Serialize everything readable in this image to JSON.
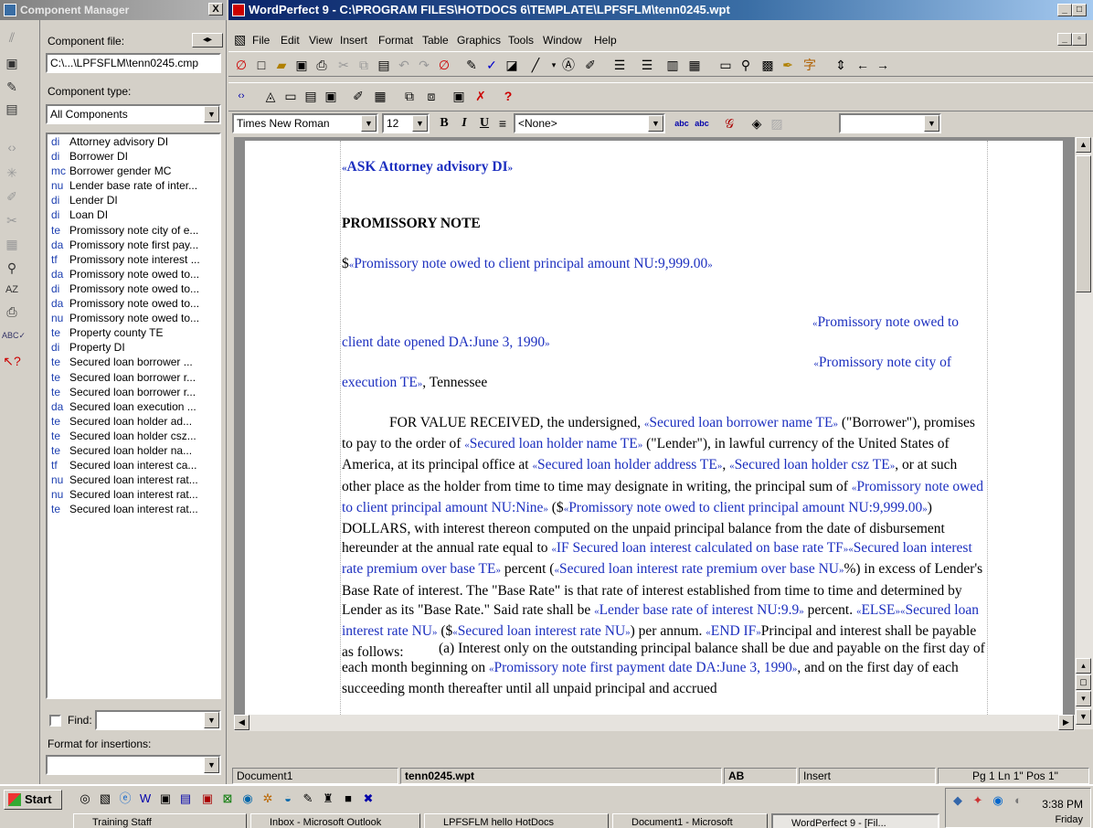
{
  "component_manager": {
    "title": "Component Manager",
    "close_label": "X",
    "file_label": "Component file:",
    "file_value": "C:\\...\\LPFSFLM\\tenn0245.cmp",
    "type_label": "Component type:",
    "type_value": "All Components",
    "items": [
      {
        "abbr": "di",
        "label": "Attorney advisory DI"
      },
      {
        "abbr": "di",
        "label": "Borrower DI"
      },
      {
        "abbr": "mc",
        "label": "Borrower gender MC"
      },
      {
        "abbr": "nu",
        "label": "Lender base rate of inter..."
      },
      {
        "abbr": "di",
        "label": "Lender DI"
      },
      {
        "abbr": "di",
        "label": "Loan DI"
      },
      {
        "abbr": "te",
        "label": "Promissory note city of e..."
      },
      {
        "abbr": "da",
        "label": "Promissory note first pay..."
      },
      {
        "abbr": "tf",
        "label": "Promissory note interest ..."
      },
      {
        "abbr": "da",
        "label": "Promissory note owed to..."
      },
      {
        "abbr": "di",
        "label": "Promissory note owed to..."
      },
      {
        "abbr": "da",
        "label": "Promissory note owed to..."
      },
      {
        "abbr": "nu",
        "label": "Promissory note owed to..."
      },
      {
        "abbr": "te",
        "label": "Property county TE"
      },
      {
        "abbr": "di",
        "label": "Property DI"
      },
      {
        "abbr": "te",
        "label": "Secured loan borrower ..."
      },
      {
        "abbr": "te",
        "label": "Secured loan borrower r..."
      },
      {
        "abbr": "te",
        "label": "Secured loan borrower r..."
      },
      {
        "abbr": "da",
        "label": "Secured loan execution ..."
      },
      {
        "abbr": "te",
        "label": "Secured loan holder ad..."
      },
      {
        "abbr": "te",
        "label": "Secured loan holder csz..."
      },
      {
        "abbr": "te",
        "label": "Secured loan holder na..."
      },
      {
        "abbr": "tf",
        "label": "Secured loan interest ca..."
      },
      {
        "abbr": "nu",
        "label": "Secured loan interest rat..."
      },
      {
        "abbr": "nu",
        "label": "Secured loan interest rat..."
      },
      {
        "abbr": "te",
        "label": "Secured loan interest rat..."
      }
    ],
    "find_label": "Find:",
    "format_label": "Format for insertions:"
  },
  "wordperfect": {
    "title": "WordPerfect 9 - C:\\PROGRAM FILES\\HOTDOCS 6\\TEMPLATE\\LPFSFLM\\tenn0245.wpt",
    "menu": [
      "File",
      "Edit",
      "View",
      "Insert",
      "Format",
      "Table",
      "Graphics",
      "Tools",
      "Window",
      "Help"
    ],
    "font_name": "Times New Roman",
    "font_size": "12",
    "style_value": "<None>",
    "bold_label": "B",
    "italic_label": "I",
    "underline_label": "U",
    "status": {
      "doc": "Document1",
      "file": "tenn0245.wpt",
      "mode_icon": "AB",
      "insert": "Insert",
      "position": "Pg 1 Ln 1\" Pos 1\""
    }
  },
  "document": {
    "advisory": "ASK Attorney advisory DI",
    "heading": "PROMISSORY NOTE",
    "amount_prefix": "$",
    "amount_field": "Promissory note owed to client principal amount NU:9,999.00",
    "date_field_a": "Promissory note owed to",
    "date_field_b": "client date opened DA:June 3, 1990",
    "city_field_a": "Promissory note city of",
    "city_field_b": "execution TE",
    "city_suffix": ", Tennessee",
    "body": [
      {
        "t": "FOR VALUE RECEIVED, the undersigned, "
      },
      {
        "f": "Secured loan borrower name TE"
      },
      {
        "t": " (\"Borrower\"), promises to pay to the order of "
      },
      {
        "f": "Secured loan holder name TE"
      },
      {
        "t": " (\"Lender\"), in lawful currency of the United States of America, at its principal office at "
      },
      {
        "f": "Secured loan holder address TE"
      },
      {
        "t": ", "
      },
      {
        "f": "Secured loan holder csz TE"
      },
      {
        "t": ", or at such other place as the holder from time to time may designate in writing, the principal sum of "
      },
      {
        "f": "Promissory note owed to client principal amount NU:Nine"
      },
      {
        "t": " ($"
      },
      {
        "f": "Promissory note owed to client principal amount NU:9,999.00"
      },
      {
        "t": ") DOLLARS, with interest thereon computed on the unpaid principal balance from the date of disbursement hereunder at the annual rate equal to "
      },
      {
        "f": "IF Secured loan interest calculated on base rate TF"
      },
      {
        "f": "Secured loan interest rate premium over base TE"
      },
      {
        "t": " percent ("
      },
      {
        "f": "Secured loan interest rate premium over base NU"
      },
      {
        "t": "%) in excess of Lender's Base Rate of interest. The \"Base Rate\" is that rate of interest established from time to time and determined by Lender as its \"Base Rate.\" Said rate shall be "
      },
      {
        "f": "Lender base rate of interest NU:9.9"
      },
      {
        "t": " percent. "
      },
      {
        "f": "ELSE"
      },
      {
        "f": "Secured loan interest rate NU"
      },
      {
        "t": " ($"
      },
      {
        "f": "Secured loan interest rate NU"
      },
      {
        "t": ") per annum. "
      },
      {
        "f": "END IF"
      },
      {
        "t": "Principal and interest shall be payable as follows:"
      }
    ],
    "para_a": [
      {
        "t": "(a) Interest only on the outstanding principal balance shall be due and payable on the first day of each month beginning on "
      },
      {
        "f": "Promissory note first payment date DA:June 3, 1990"
      },
      {
        "t": ", and on the first day of each succeeding month thereafter until all unpaid principal and accrued"
      }
    ]
  },
  "taskbar": {
    "start_label": "Start",
    "clock": "3:38 PM",
    "day": "Friday",
    "tasks": [
      "Training Staff",
      "Inbox - Microsoft Outlook",
      "LPFSFLM hello HotDocs",
      "Document1 - Microsoft",
      "WordPerfect 9 - [Fil..."
    ]
  },
  "colors": {
    "field_blue": "#1c2fbf",
    "title_active": "#0a246a",
    "title_inactive": "#808080"
  }
}
